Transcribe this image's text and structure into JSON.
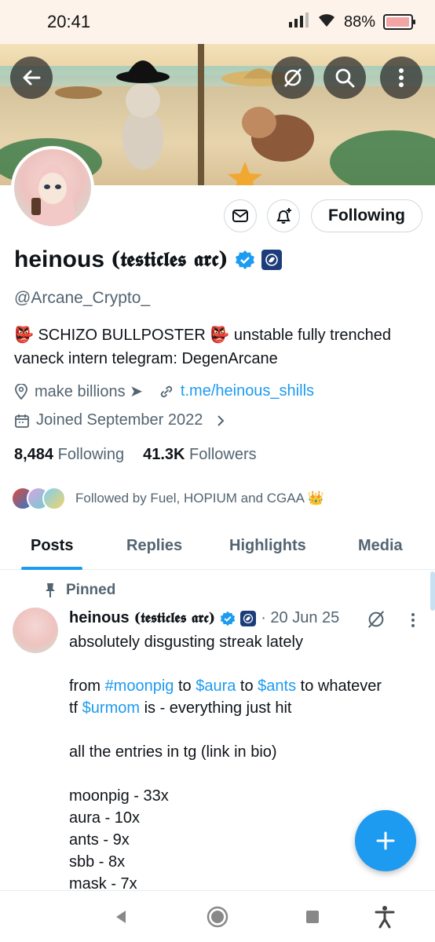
{
  "status_bar": {
    "time": "20:41",
    "battery": "88%",
    "battery_level": 0.88
  },
  "profile": {
    "name_plain": "heinous",
    "name_fancy": "(𝖙𝖊𝖘𝖙𝖎𝖈𝖑𝖊𝖘 𝖆𝖗𝖈)",
    "handle": "@Arcane_Crypto_",
    "bio_line1": "👺 SCHIZO BULLPOSTER 👺  unstable fully trenched",
    "bio_line2": "vaneck intern  telegram: DegenArcane",
    "location": "make billions ➤",
    "link": "t.me/heinous_shills",
    "joined": "Joined September 2022",
    "following_count": "8,484",
    "following_label": "Following",
    "followers_count": "41.3K",
    "followers_label": "Followers",
    "followed_by": "Followed by Fuel, HOPIUM and CGAA 👑",
    "follow_button": "Following"
  },
  "tabs": [
    "Posts",
    "Replies",
    "Highlights",
    "Media"
  ],
  "tweet": {
    "pinned_label": "Pinned",
    "name_plain": "heinous",
    "name_fancy": "(𝖙𝖊𝖘𝖙𝖎𝖈𝖑𝖊𝖘 𝖆𝖗𝖈)",
    "date": "· 20 Jun 25",
    "line1": "absolutely disgusting streak lately",
    "line2_a": "from ",
    "line2_tag1": "#moonpig",
    "line2_b": " to ",
    "line2_tag2": "$aura",
    "line2_c": " to ",
    "line2_tag3": "$ants",
    "line2_d": " to whatever",
    "line3_a": "tf ",
    "line3_tag": "$urmom",
    "line3_b": " is - everything just hit",
    "line4": "all the entries in tg (link in bio)",
    "list": [
      "moonpig - 33x",
      "aura - 10x",
      "ants - 9x",
      "sbb - 8x",
      "mask - 7x"
    ]
  },
  "colors": {
    "accent": "#1d9bf0",
    "text": "#0f1419",
    "muted": "#536471"
  }
}
